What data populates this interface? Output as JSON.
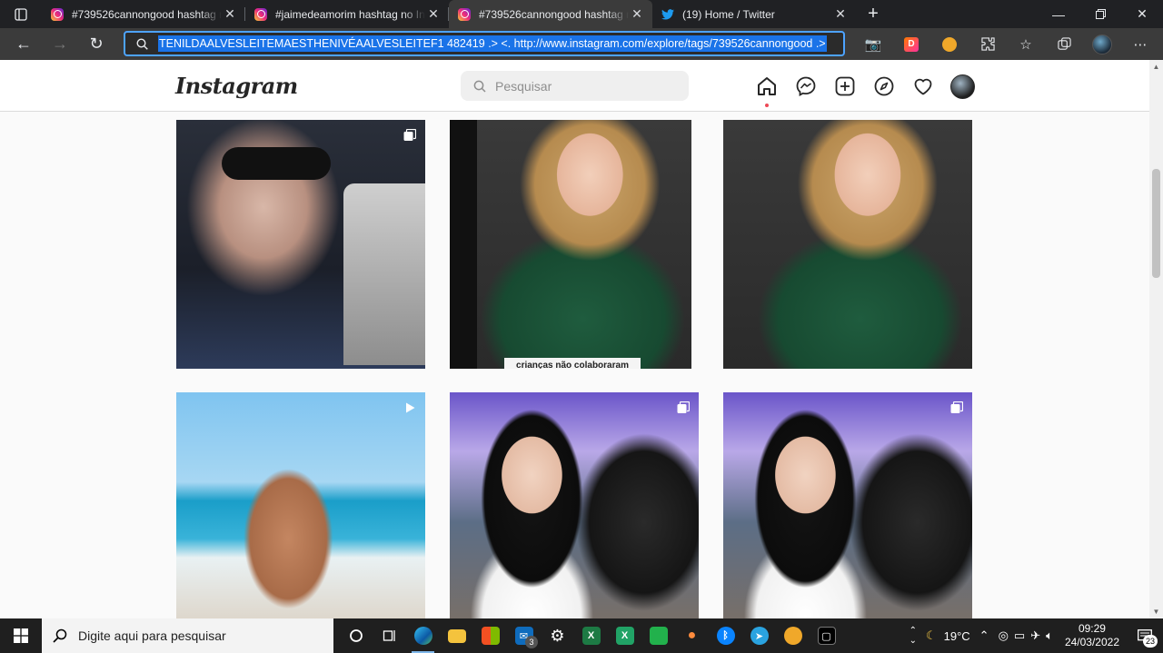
{
  "browser": {
    "tabs": [
      {
        "title": "#739526cannongood hashtag no Instagram",
        "favicon": "instagram-icon",
        "active": false
      },
      {
        "title": "#jaimedeamorim hashtag no Instagram",
        "favicon": "instagram-icon",
        "active": false
      },
      {
        "title": "#739526cannongood hashtag no Instagram",
        "favicon": "instagram-icon",
        "active": true
      },
      {
        "title": "(19) Home / Twitter",
        "favicon": "twitter-icon",
        "active": false
      }
    ],
    "address": "TENILDAALVESLEITEMAESTHENIVÉAALVESLEITEF1 482419 .> <. http://www.instagram.com/explore/tags/739526cannongood .>",
    "accent": "#1a73e8"
  },
  "instagram": {
    "logo": "Instagram",
    "search_placeholder": "Pesquisar",
    "nav_icons": [
      "home-icon",
      "messenger-icon",
      "new-post-icon",
      "explore-icon",
      "activity-heart-icon",
      "profile-avatar"
    ]
  },
  "grid": [
    {
      "post": "post-1",
      "type": "carousel-icon"
    },
    {
      "post": "post-2",
      "type": "none",
      "caption": "crianças não colaboraram"
    },
    {
      "post": "post-3",
      "type": "none"
    },
    {
      "post": "post-4",
      "type": "reel-icon"
    },
    {
      "post": "post-5",
      "type": "carousel-icon"
    },
    {
      "post": "post-6",
      "type": "carousel-icon"
    }
  ],
  "taskbar": {
    "search_placeholder": "Digite aqui para pesquisar",
    "mail_count": "3",
    "weather": "19°C",
    "time": "09:29",
    "date": "24/03/2022",
    "notifications": "23"
  }
}
